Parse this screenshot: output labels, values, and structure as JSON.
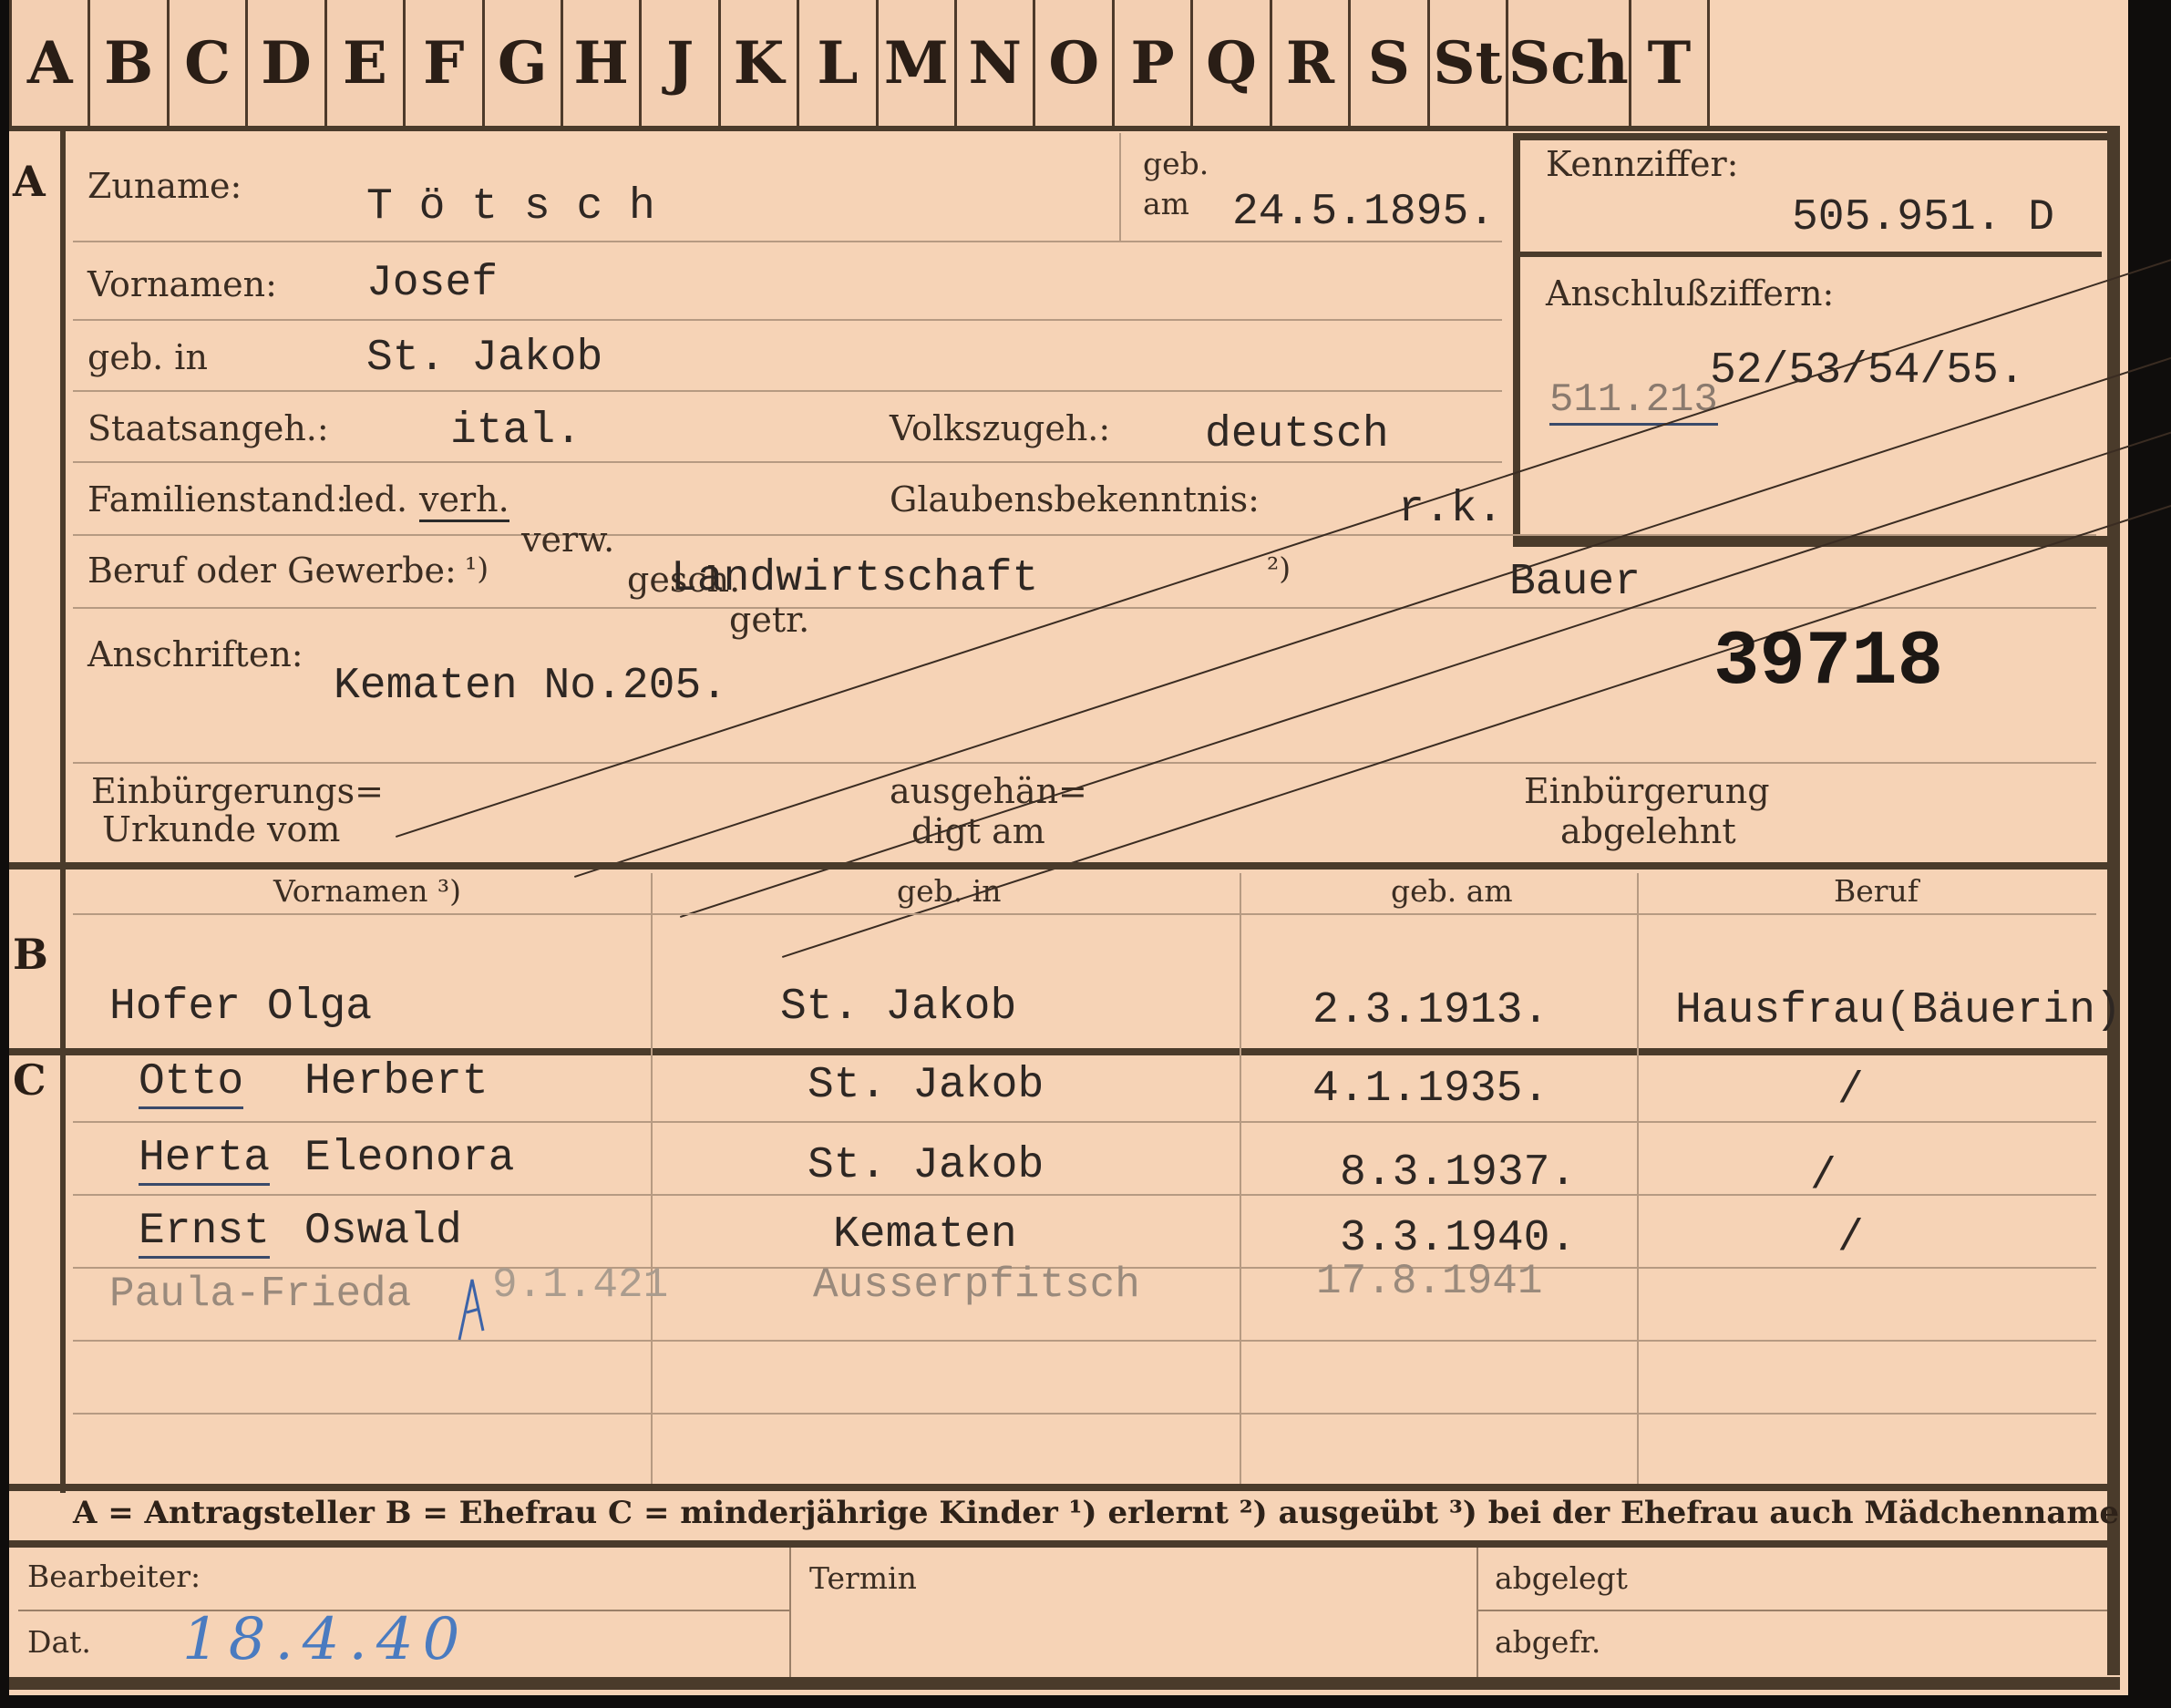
{
  "tabs": [
    "A",
    "B",
    "C",
    "D",
    "E",
    "F",
    "G",
    "H",
    "J",
    "K",
    "L",
    "M",
    "N",
    "O",
    "P",
    "Q",
    "R",
    "S",
    "St",
    "Sch",
    "T"
  ],
  "sections": {
    "a": "A",
    "b": "B",
    "c": "C"
  },
  "applicant": {
    "surname_label": "Zuname:",
    "surname": "T ö t s c h",
    "born_on_label_1": "geb.",
    "born_on_label_2": "am",
    "born_on": "24.5.1895.",
    "id_label": "Kennziffer:",
    "id_number": "505.951. D",
    "connect_label": "Anschlußziffern:",
    "connect_numbers": "52/53/54/55.",
    "connect_old": "511.213",
    "given_label": "Vornamen:",
    "given_names": "Josef",
    "birthplace_label": "geb. in",
    "birthplace": "St. Jakob",
    "citizenship_label": "Staatsangeh.:",
    "citizenship": "ital.",
    "ethnicity_label": "Volkszugeh.:",
    "ethnicity": "deutsch",
    "marital_label": "Familienstand:",
    "marital_opt_1": "led.",
    "marital_opt_2": "verh.",
    "marital_opt_3": "verw.",
    "marital_opt_4": "gesch.",
    "marital_opt_5": "getr.",
    "religion_label": "Glaubensbekenntnis:",
    "religion": "r.k.",
    "occupation_label": "Beruf oder Gewerbe:",
    "occupation_fn1": "¹)",
    "occupation_learned": "Landwirtschaft",
    "occupation_fn2": "²)",
    "occupation_practiced": "Bauer",
    "address_label": "Anschriften:",
    "address": "Kematen No.205.",
    "stamp_number": "39718",
    "naturalization_label_1": "Einbürgerungs=",
    "naturalization_label_2": "Urkunde vom",
    "issued_label_1": "ausgehän=",
    "issued_label_2": "digt am",
    "rejected_label_1": "Einbürgerung",
    "rejected_label_2": "abgelehnt"
  },
  "table_headers": {
    "given": "Vornamen ³)",
    "birthplace": "geb. in",
    "born_on": "geb. am",
    "occupation": "Beruf"
  },
  "spouse": {
    "name": "Hofer Olga",
    "birthplace": "St. Jakob",
    "born_on": "2.3.1913.",
    "occupation": "Hausfrau(Bäuerin)"
  },
  "children": [
    {
      "first": "Otto",
      "middle": "Herbert",
      "birthplace": "St. Jakob",
      "born_on": "4.1.1935.",
      "occupation": "/"
    },
    {
      "first": "Herta",
      "middle": "Eleonora",
      "birthplace": "St. Jakob",
      "born_on": "8.3.1937.",
      "occupation": "/"
    },
    {
      "first": "Ernst",
      "middle": "Oswald",
      "birthplace": "Kematen",
      "born_on": "3.3.1940.",
      "occupation": "/"
    }
  ],
  "added_child": {
    "name": "Paula-Frieda",
    "date_note": "9.1.421",
    "birthplace": "Ausserpfitsch",
    "born_on": "17.8.1941"
  },
  "legend": "A = Antragsteller   B = Ehefrau   C = minderjährige Kinder   ¹) erlernt   ²) ausgeübt   ³) bei der Ehefrau auch Mädchenname",
  "footer": {
    "clerk_label": "Bearbeiter:",
    "date_label": "Dat.",
    "date_value": "18.4.40",
    "deadline_label": "Termin",
    "filed_label": "abgelegt",
    "delivered_label": "abgefr."
  }
}
